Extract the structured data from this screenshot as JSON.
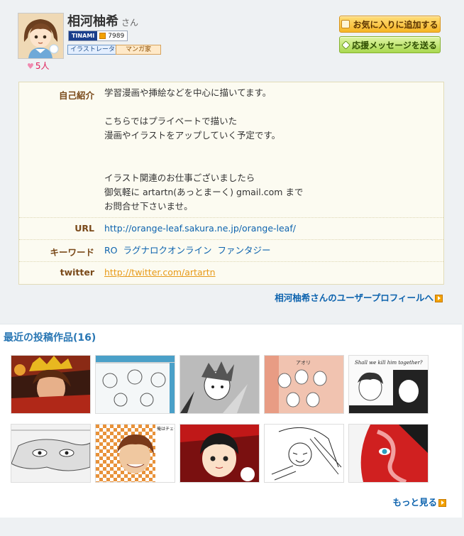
{
  "user": {
    "name": "相河柚希",
    "honorific": "さん",
    "tinami_logo": "TINAMI",
    "tinami_number": "7989",
    "tags": [
      "イラストレーター",
      "マンガ家"
    ],
    "favorite_count": "5人"
  },
  "buttons": {
    "add_favorite": "お気に入りに追加する",
    "send_message": "応援メッセージを送る"
  },
  "profile": {
    "intro_label": "自己紹介",
    "intro_lines": [
      "学習漫画や挿絵などを中心に描いてます。",
      "",
      "こちらではプライベートで描いた",
      "漫画やイラストをアップしていく予定です。",
      "",
      "",
      "イラスト関連のお仕事ございましたら",
      "御気軽に artartn(あっとまーく) gmail.com まで",
      "お問合せ下さいませ。"
    ],
    "url_label": "URL",
    "url_value": "http://orange-leaf.sakura.ne.jp/orange-leaf/",
    "keyword_label": "キーワード",
    "keywords": [
      "RO",
      "ラグナロクオンライン",
      "ファンタジー"
    ],
    "twitter_label": "twitter",
    "twitter_value": "http://twitter.com/artartn"
  },
  "user_profile_link": "相河柚希さんのユーザープロフィールへ",
  "works": {
    "heading": "最近の投稿作品(16)",
    "thumbnails": [
      {
        "text": ""
      },
      {
        "text": ""
      },
      {
        "text": ""
      },
      {
        "text": "アオリ"
      },
      {
        "text": "Shall we kill him together?"
      },
      {
        "text": ""
      },
      {
        "text": "俺はチェイニー 特技は誰にでも変身できることさ"
      },
      {
        "text": ""
      },
      {
        "text": ""
      },
      {
        "text": ""
      }
    ],
    "more_link": "もっと見る"
  },
  "colors": {
    "link": "#0d63ae",
    "label": "#7a4a1a",
    "heading": "#2a77b4",
    "twitter": "#e79a18"
  }
}
